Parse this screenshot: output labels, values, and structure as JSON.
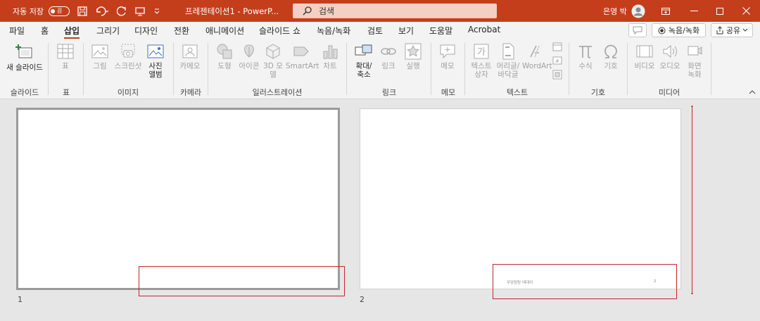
{
  "titlebar": {
    "autosave_label": "자동 저장",
    "autosave_state": "끔",
    "doc_title": "프레젠테이션1 - PowerP...",
    "search_placeholder": "검색",
    "user_name": "은영 박"
  },
  "tabs": [
    "파일",
    "홈",
    "삽입",
    "그리기",
    "디자인",
    "전환",
    "애니메이션",
    "슬라이드 쇼",
    "녹음/녹화",
    "검토",
    "보기",
    "도움말",
    "Acrobat"
  ],
  "active_tab": "삽입",
  "right_buttons": {
    "record": "녹음/녹화",
    "share": "공유"
  },
  "ribbon": {
    "new_slide": "새 슬라이드",
    "table": "표",
    "picture": "그림",
    "screenshot": "스크린샷",
    "photo_album": "사진 앨범",
    "cameo": "카메오",
    "shapes": "도형",
    "icons": "아이콘",
    "model_3d": "3D 모델",
    "smartart": "SmartArt",
    "chart": "차트",
    "zoom": "확대/ 축소",
    "link": "링크",
    "action": "실행",
    "comment": "메모",
    "textbox": "텍스트 상자",
    "header_footer": "머리글/ 바닥글",
    "wordart": "WordArt",
    "equation": "수식",
    "symbol": "기호",
    "video": "비디오",
    "audio": "오디오",
    "screen_recording": "화면 녹화",
    "groups": {
      "slides": "슬라이드",
      "table": "표",
      "images": "이미지",
      "camera": "카메라",
      "illustrations": "일러스트레이션",
      "links": "링크",
      "comments": "메모",
      "text": "텍스트",
      "symbols": "기호",
      "media": "미디어"
    }
  },
  "slides": [
    {
      "number": "1",
      "footer_text": "",
      "page_number": ""
    },
    {
      "number": "2",
      "footer_text": "우당탕탕 테대리",
      "page_number": "2"
    }
  ],
  "colors": {
    "accent": "#c43e1c",
    "highlight": "#c0282d"
  }
}
